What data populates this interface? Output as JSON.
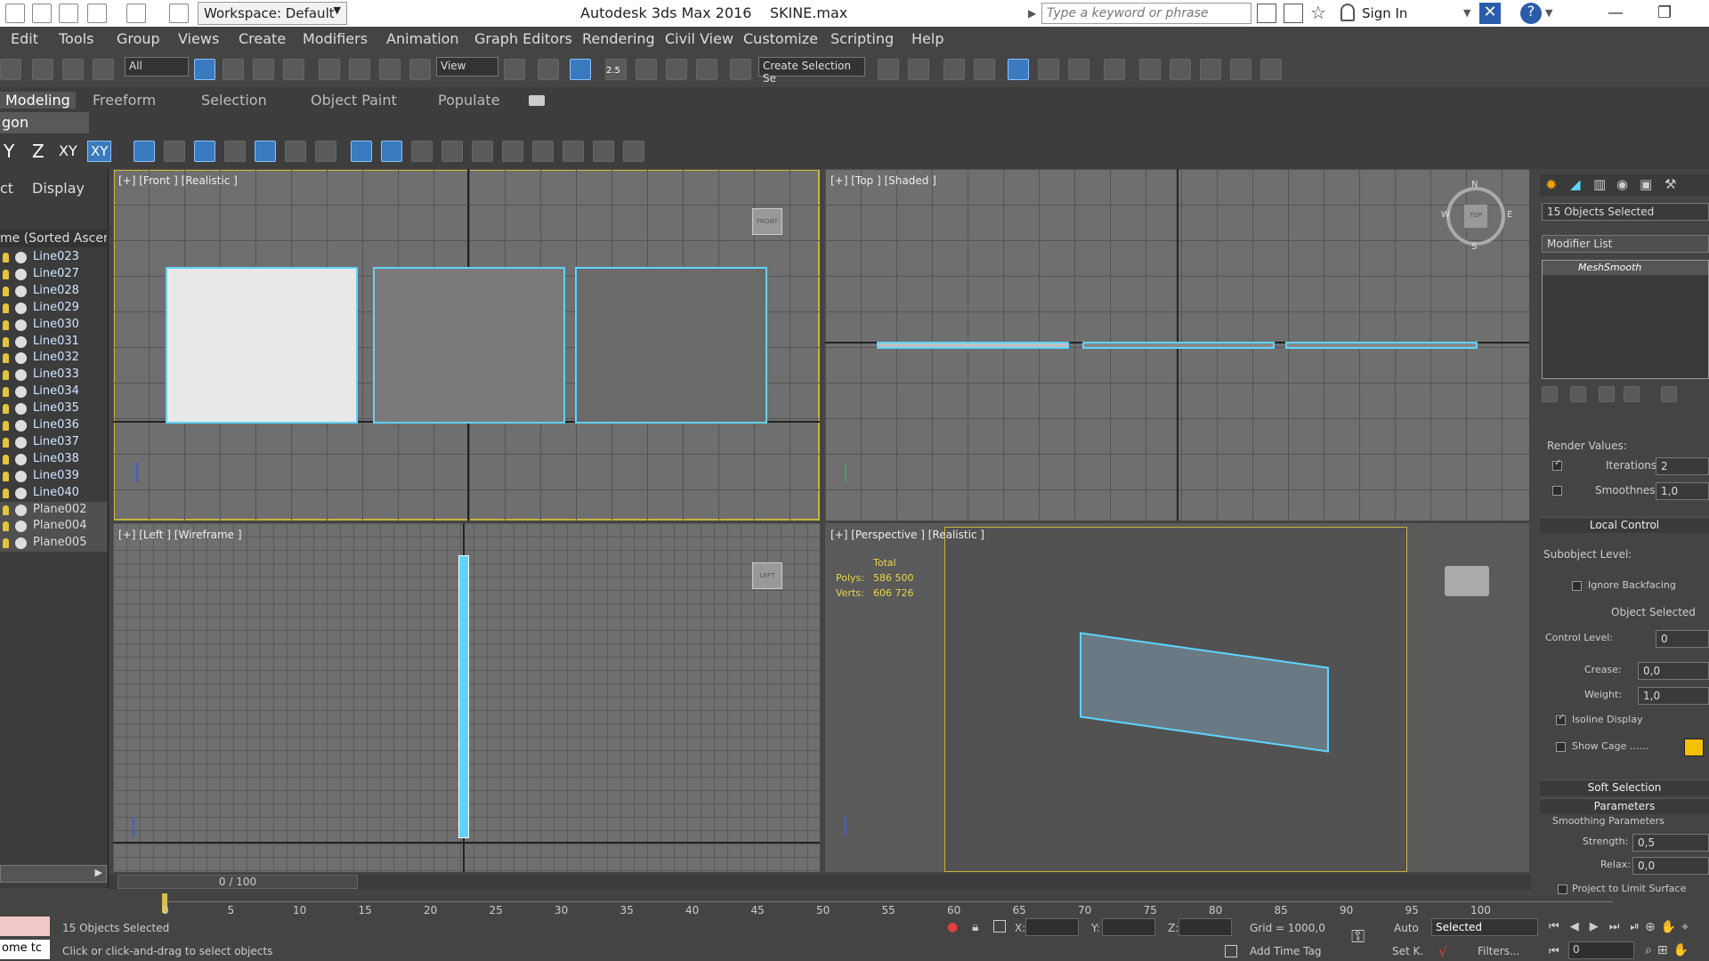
{
  "titlebar": {
    "workspace": "Workspace: Default",
    "app_title": "Autodesk 3ds Max 2016",
    "file_name": "SKINE.max",
    "search_placeholder": "Type a keyword or phrase",
    "sign_in": "Sign In"
  },
  "menu": [
    "Edit",
    "Tools",
    "Group",
    "Views",
    "Create",
    "Modifiers",
    "Animation",
    "Graph Editors",
    "Rendering",
    "Civil View",
    "Customize",
    "Scripting",
    "Help"
  ],
  "toolbar": {
    "selection_filter": "All",
    "reference_coord": "View",
    "snap_value": "2.5",
    "named_selection": "Create Selection Se"
  },
  "ribbon": {
    "tabs": [
      "Modeling",
      "Freeform",
      "Selection",
      "Object Paint",
      "Populate"
    ],
    "subpanel": "gon Modeling",
    "axis_buttons": [
      "Y",
      "Z",
      "XY",
      "XY"
    ]
  },
  "scene_explorer": {
    "tabs": [
      "ct",
      "Display"
    ],
    "sort_header": "me (Sorted Ascendi",
    "items": [
      {
        "name": "Line023",
        "type": "line"
      },
      {
        "name": "Line027",
        "type": "line"
      },
      {
        "name": "Line028",
        "type": "line"
      },
      {
        "name": "Line029",
        "type": "line"
      },
      {
        "name": "Line030",
        "type": "line"
      },
      {
        "name": "Line031",
        "type": "line"
      },
      {
        "name": "Line032",
        "type": "line"
      },
      {
        "name": "Line033",
        "type": "line"
      },
      {
        "name": "Line034",
        "type": "line"
      },
      {
        "name": "Line035",
        "type": "line"
      },
      {
        "name": "Line036",
        "type": "line"
      },
      {
        "name": "Line037",
        "type": "line"
      },
      {
        "name": "Line038",
        "type": "line"
      },
      {
        "name": "Line039",
        "type": "line"
      },
      {
        "name": "Line040",
        "type": "line"
      },
      {
        "name": "Plane002",
        "type": "plane"
      },
      {
        "name": "Plane004",
        "type": "plane"
      },
      {
        "name": "Plane005",
        "type": "plane"
      }
    ]
  },
  "viewports": {
    "front": {
      "label": "[+] [Front ] [Realistic ]",
      "cube": "FRONT"
    },
    "top": {
      "label": "[+] [Top ] [Shaded ]",
      "cube": "TOP",
      "compass": [
        "N",
        "S",
        "W",
        "E"
      ]
    },
    "left": {
      "label": "[+] [Left ] [Wireframe ]",
      "cube": "LEFT"
    },
    "perspective": {
      "label": "[+] [Perspective ] [Realistic ]",
      "stats_title": "Total",
      "polys_label": "Polys:",
      "polys": "586 500",
      "verts_label": "Verts:",
      "verts": "606 726"
    }
  },
  "command_panel": {
    "selection": "15 Objects Selected",
    "modifier_list": "Modifier List",
    "modifier": "MeshSmooth",
    "render_values": "Render Values:",
    "iterations_label": "Iterations:",
    "iterations": "2",
    "smoothness_label": "Smoothness:",
    "smoothness": "1,0",
    "local_control": "Local Control",
    "subobject_level": "Subobject Level:",
    "ignore_backfacing": "Ignore Backfacing",
    "object_selected": "Object Selected",
    "control_level_label": "Control Level:",
    "control_level": "0",
    "crease_label": "Crease:",
    "crease": "0,0",
    "weight_label": "Weight:",
    "weight": "1,0",
    "isoline_display": "Isoline Display",
    "show_cage": "Show Cage ......",
    "soft_selection": "Soft Selection",
    "parameters": "Parameters",
    "smoothing_parameters": "Smoothing Parameters",
    "strength_label": "Strength:",
    "strength": "0,5",
    "relax_label": "Relax:",
    "relax": "0,0",
    "project_limit": "Project to Limit Surface",
    "cage_color": "#f5c000"
  },
  "timeline": {
    "frame": "0 / 100",
    "ticks": [
      "0",
      "5",
      "10",
      "15",
      "20",
      "25",
      "30",
      "35",
      "40",
      "45",
      "50",
      "55",
      "60",
      "65",
      "70",
      "75",
      "80",
      "85",
      "90",
      "95",
      "100"
    ]
  },
  "status": {
    "selected": "15 Objects Selected",
    "prompt": "Click or click-and-drag to select objects",
    "x_label": "X:",
    "y_label": "Y:",
    "z_label": "Z:",
    "grid": "Grid = 1000,0",
    "add_time_tag": "Add Time Tag",
    "auto": "Auto",
    "set_key": "Set K.",
    "key_filter": "Selected",
    "filters": "Filters...",
    "frame_field": "0",
    "maxscript": "ome  tc"
  }
}
